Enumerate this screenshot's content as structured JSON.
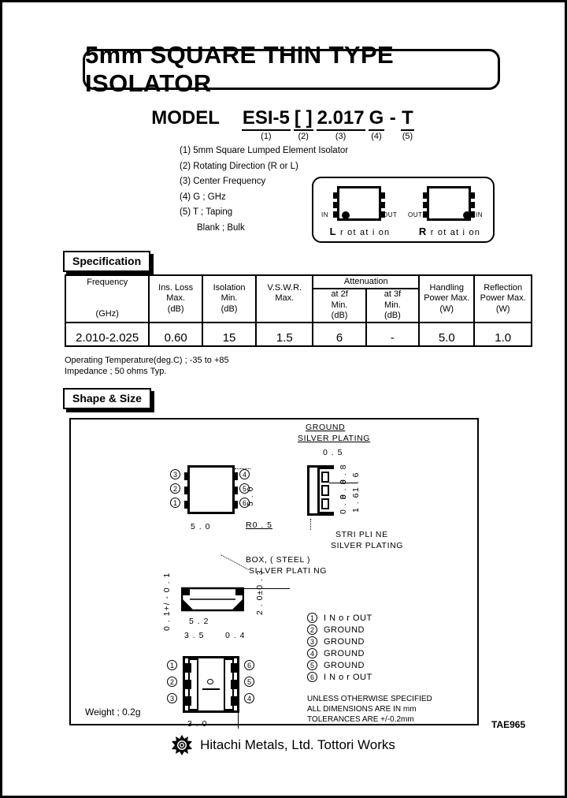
{
  "title": "5mm SQUARE THIN TYPE ISOLATOR",
  "model": {
    "word": "MODEL",
    "segments": [
      {
        "value": "ESI-5",
        "index": "(1)"
      },
      {
        "value": "[ ]",
        "index": "(2)"
      },
      {
        "value": "2.017",
        "index": "(3)"
      },
      {
        "value": "G",
        "index": "(4)"
      },
      {
        "value": "-",
        "index": ""
      },
      {
        "value": "T",
        "index": "(5)"
      }
    ]
  },
  "legend": [
    "(1) 5mm Square Lumped Element Isolator",
    "(2) Rotating Direction (R or L)",
    "(3) Center Frequency",
    "(4) G ; GHz",
    "(5) T ; Taping"
  ],
  "legend_indent": "Blank ; Bulk",
  "rotation": {
    "left": {
      "in": "IN",
      "out": "OUT",
      "letter": "L",
      "name": "r ot at i on"
    },
    "right": {
      "in": "IN",
      "out": "OUT",
      "letter": "R",
      "name": "r ot at i on"
    }
  },
  "spec_tag": "Specification",
  "spec_table": {
    "headers": [
      {
        "lines": [
          "Frequency",
          "",
          "(GHz)"
        ]
      },
      {
        "lines": [
          "Ins. Loss",
          "Max.",
          "(dB)"
        ]
      },
      {
        "lines": [
          "Isolation",
          "Min.",
          "(dB)"
        ]
      },
      {
        "lines": [
          "V.S.W.R.",
          "Max.",
          ""
        ]
      },
      {
        "lines": [
          "at 2f",
          "Min.",
          "(dB)"
        ]
      },
      {
        "lines": [
          "at 3f",
          "Min.",
          "(dB)"
        ]
      },
      {
        "lines": [
          "Handling",
          "Power Max.",
          "(W)"
        ]
      },
      {
        "lines": [
          "Reflection",
          "Power Max.",
          "(W)"
        ]
      }
    ],
    "group_header": "Attenuation",
    "values": [
      "2.010-2.025",
      "0.60",
      "15",
      "1.5",
      "6",
      "-",
      "5.0",
      "1.0"
    ]
  },
  "notes": {
    "temperature": "Operating Temperature(deg.C) ;  -35  to  +85",
    "impedance": "Impedance ; 50 ohms Typ."
  },
  "shape_tag": "Shape & Size",
  "drawing": {
    "ground_label1": "GROUND",
    "ground_label2": "SILVER PLATING",
    "stripline_label1": "STRI PLI NE",
    "stripline_label2": "SILVER PLATING",
    "box_label1": "BOX, ( STEEL )",
    "box_label2": "SI LVER PLATI NG",
    "top_width": "5 . 0",
    "top_height": "5 . 0",
    "corner_radius": "R0 . 5",
    "side_top": "0 . 5",
    "side_dims_a": [
      "0 . 8",
      "0 . 8",
      "0 . 8"
    ],
    "side_dims_b": [
      "1 . 6",
      "1 . 6"
    ],
    "front_height": "0 . 1+/ - 0 . 1",
    "front_width": "5 . 2",
    "front_inner": "3 . 5",
    "front_small": "0 . 4",
    "front_thick": "2 . 0±0 . 3",
    "bottom_dim": "3 . 0",
    "pins": [
      {
        "num": "1",
        "label": "I N  o r   OUT"
      },
      {
        "num": "2",
        "label": "GROUND"
      },
      {
        "num": "3",
        "label": "GROUND"
      },
      {
        "num": "4",
        "label": "GROUND"
      },
      {
        "num": "5",
        "label": "GROUND"
      },
      {
        "num": "6",
        "label": "I N  o r   OUT"
      }
    ],
    "top_pins_left": [
      "3",
      "2",
      "1"
    ],
    "top_pins_right": [
      "4",
      "5",
      "6"
    ],
    "bottom_pins_left": [
      "1",
      "2",
      "3"
    ],
    "bottom_pins_right": [
      "6",
      "5",
      "4"
    ],
    "weight": "Weight ; 0.2g",
    "spec_note": [
      "UNLESS OTHERWISE SPECIFIED",
      "ALL DIMENSIONS ARE IN mm",
      "TOLERANCES ARE +/-0.2mm"
    ]
  },
  "footer": {
    "company": "Hitachi Metals, Ltd.  Tottori Works",
    "code": "TAE965"
  }
}
